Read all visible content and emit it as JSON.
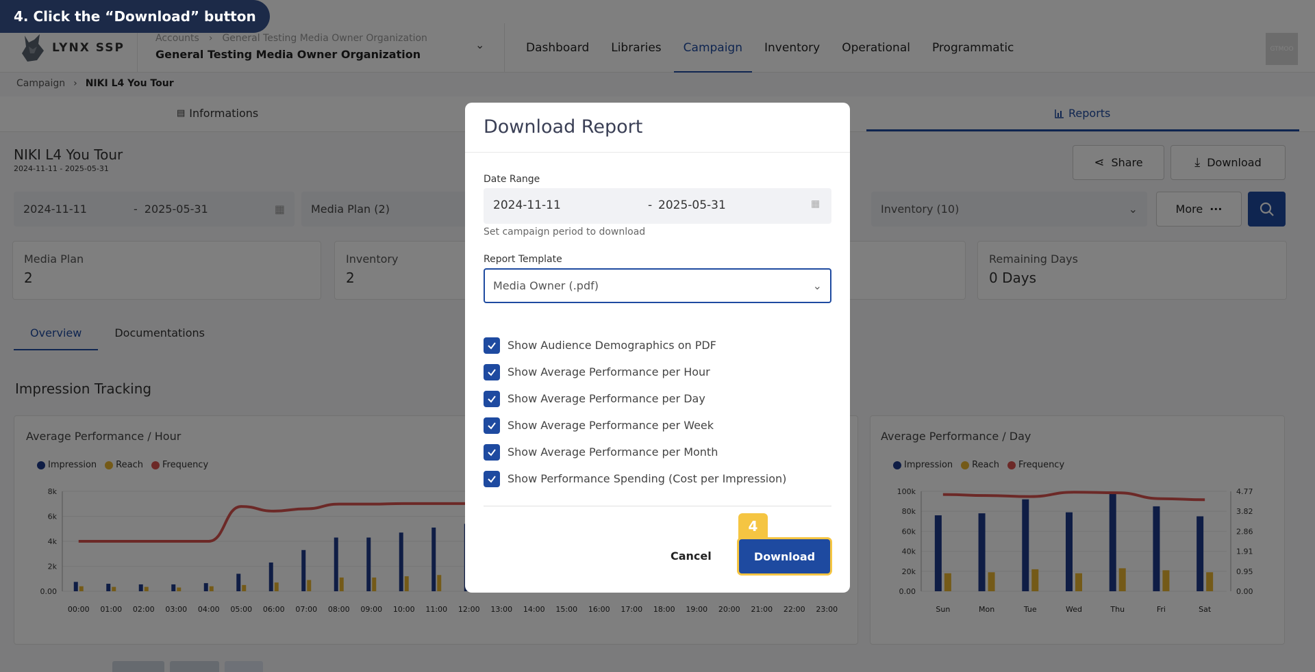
{
  "instruction": "4. Click the “Download” button",
  "header": {
    "logo_text": "LYNX SSP",
    "org_crumb_root": "Accounts",
    "org_crumb_child": "General Testing Media Owner Organization",
    "org_name": "General Testing Media Owner Organization",
    "nav": [
      "Dashboard",
      "Libraries",
      "Campaign",
      "Inventory",
      "Operational",
      "Programmatic"
    ],
    "nav_active": "Campaign",
    "avatar_text": "GTMOO"
  },
  "breadcrumb": {
    "parent": "Campaign",
    "current": "NIKI L4 You Tour"
  },
  "tabs": {
    "informations": "Informations",
    "reports": "Reports"
  },
  "campaign": {
    "title": "NIKI L4 You Tour",
    "dates": "2024-11-11 - 2025-05-31",
    "share_label": "Share",
    "download_label": "Download"
  },
  "filters": {
    "date_start": "2024-11-11",
    "date_sep": "-",
    "date_end": "2025-05-31",
    "media_plan": "Media Plan (2)",
    "inventory": "Inventory (10)",
    "more_label": "More"
  },
  "cards": [
    {
      "label": "Media Plan",
      "value": "2"
    },
    {
      "label": "Inventory",
      "value": "2"
    },
    {
      "label": "Remaining Days",
      "value": "0 Days"
    }
  ],
  "subtabs": {
    "overview": "Overview",
    "documentations": "Documentations"
  },
  "section_title": "Impression Tracking",
  "legend": {
    "impression": "Impression",
    "reach": "Reach",
    "frequency": "Frequency"
  },
  "colors": {
    "impression": "#1f3a8a",
    "reach": "#e8b530",
    "frequency": "#d9534f",
    "primary": "#1e4aa0",
    "highlight": "#f5c542"
  },
  "chart_data": [
    {
      "type": "bar",
      "title": "Average Performance / Hour",
      "categories": [
        "00:00",
        "01:00",
        "02:00",
        "03:00",
        "04:00",
        "05:00",
        "06:00",
        "07:00",
        "08:00",
        "09:00",
        "10:00",
        "11:00",
        "12:00",
        "13:00",
        "14:00",
        "15:00",
        "16:00",
        "17:00",
        "18:00",
        "19:00",
        "20:00",
        "21:00",
        "22:00",
        "23:00"
      ],
      "yticks": [
        "0.00",
        "2k",
        "4k",
        "6k",
        "8k"
      ],
      "ylim": [
        0,
        8000
      ],
      "series": [
        {
          "name": "Impression",
          "values": [
            750,
            600,
            550,
            550,
            650,
            1400,
            2300,
            3300,
            4300,
            4300,
            4700,
            5100,
            5400,
            0,
            0,
            0,
            0,
            0,
            0,
            0,
            0,
            0,
            0,
            0
          ]
        },
        {
          "name": "Reach",
          "values": [
            400,
            350,
            350,
            300,
            400,
            500,
            700,
            900,
            1100,
            1100,
            1200,
            1300,
            1350,
            0,
            0,
            0,
            0,
            0,
            0,
            0,
            0,
            0,
            0,
            0
          ]
        },
        {
          "name": "Frequency",
          "values": [
            4.3,
            4.3,
            4.3,
            4.3,
            4.3,
            7.3,
            6.9,
            7.1,
            7.5,
            7.5,
            7.55,
            7.55,
            7.55,
            7.55,
            7.55,
            7.55,
            7.55,
            7.55,
            7.55,
            7.55,
            7.55,
            7.55,
            7.55,
            7.55
          ]
        }
      ]
    },
    {
      "type": "bar",
      "title": "Average Performance / Day",
      "categories": [
        "Sun",
        "Mon",
        "Tue",
        "Wed",
        "Thu",
        "Fri",
        "Sat"
      ],
      "yticks": [
        "0.00",
        "20k",
        "40k",
        "60k",
        "80k",
        "100k"
      ],
      "ylim": [
        0,
        100000
      ],
      "y2ticks": [
        "0.00",
        "0.95",
        "1.91",
        "2.86",
        "3.82",
        "4.77"
      ],
      "y2lim": [
        0,
        4.77
      ],
      "series": [
        {
          "name": "Impression",
          "values": [
            76000,
            78000,
            92000,
            79000,
            98000,
            85000,
            75000
          ]
        },
        {
          "name": "Reach",
          "values": [
            18000,
            19000,
            22000,
            18000,
            23000,
            21000,
            19000
          ]
        },
        {
          "name": "Frequency",
          "values": [
            4.62,
            4.57,
            4.52,
            4.73,
            4.7,
            4.42,
            4.37
          ]
        }
      ]
    }
  ],
  "modal": {
    "title": "Download Report",
    "date_range_label": "Date Range",
    "date_start": "2024-11-11",
    "date_sep": "-",
    "date_end": "2025-05-31",
    "date_help": "Set campaign period to download",
    "template_label": "Report Template",
    "template_value": "Media Owner (.pdf)",
    "checkboxes": [
      {
        "label": "Show Audience Demographics on PDF",
        "checked": true
      },
      {
        "label": "Show Average Performance per Hour",
        "checked": true
      },
      {
        "label": "Show Average Performance per Day",
        "checked": true
      },
      {
        "label": "Show Average Performance per Week",
        "checked": true
      },
      {
        "label": "Show Average Performance per Month",
        "checked": true
      },
      {
        "label": "Show Performance Spending (Cost per Impression)",
        "checked": true
      }
    ],
    "cancel_label": "Cancel",
    "download_label": "Download",
    "step_badge": "4"
  }
}
